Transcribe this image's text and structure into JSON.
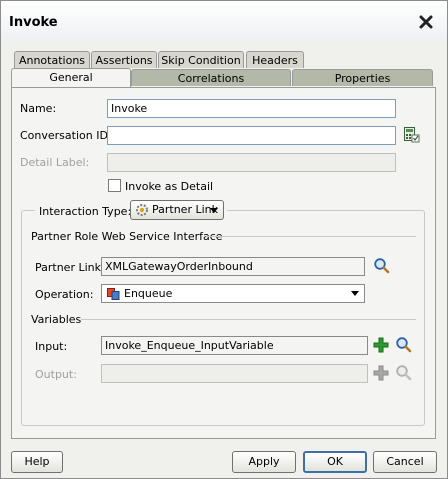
{
  "dialog": {
    "title": "Invoke"
  },
  "tabs_back": [
    "Annotations",
    "Assertions",
    "Skip Condition",
    "Headers"
  ],
  "tabs_front": [
    "General",
    "Correlations",
    "Properties"
  ],
  "form": {
    "name_label": "Name:",
    "name_value": "Invoke",
    "conversation_label": "Conversation ID:",
    "conversation_value": "",
    "detail_label": "Detail Label:",
    "detail_value": "",
    "invoke_as_detail_label": "Invoke as Detail",
    "invoke_as_detail_checked": false
  },
  "interaction": {
    "type_label": "Interaction Type:",
    "type_value": "Partner Link",
    "section_title": "Partner Role Web Service Interface",
    "partner_link_label": "Partner Link:",
    "partner_link_value": "XMLGatewayOrderInbound",
    "operation_label": "Operation:",
    "operation_value": "Enqueue"
  },
  "variables": {
    "title": "Variables",
    "input_label": "Input:",
    "input_value": "Invoke_Enqueue_InputVariable",
    "output_label": "Output:",
    "output_value": ""
  },
  "buttons": {
    "help": "Help",
    "apply": "Apply",
    "ok": "OK",
    "cancel": "Cancel"
  },
  "colors": {
    "accent": "#3d6ea6",
    "add_green": "#2e9a2e",
    "tab_gray": "#b4b8a8"
  }
}
